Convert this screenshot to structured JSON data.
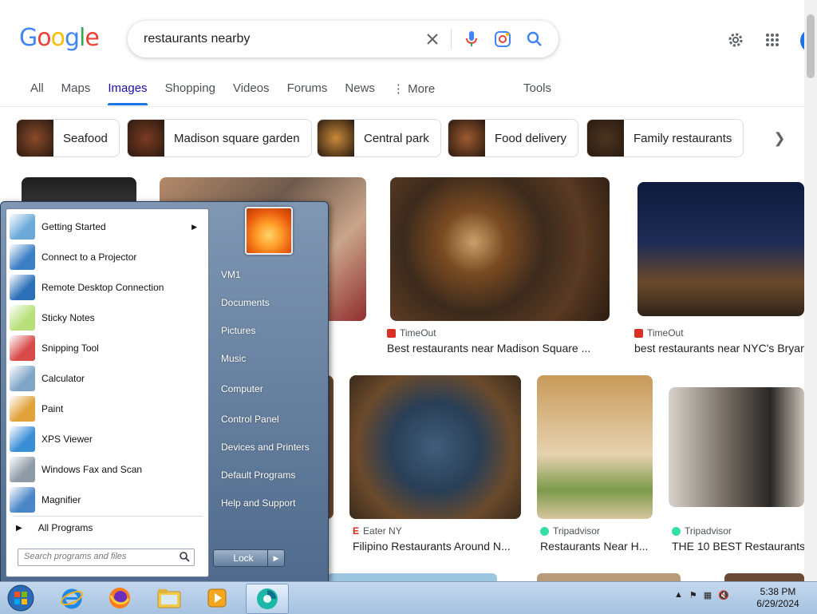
{
  "google": {
    "logo_letters": [
      "G",
      "o",
      "o",
      "g",
      "l",
      "e"
    ],
    "logo_colors": [
      "#4285F4",
      "#EA4335",
      "#FBBC05",
      "#4285F4",
      "#34A853",
      "#EA4335"
    ],
    "query": "restaurants nearby",
    "tabs": [
      {
        "label": "All",
        "active": false
      },
      {
        "label": "Maps",
        "active": false
      },
      {
        "label": "Images",
        "active": true
      },
      {
        "label": "Shopping",
        "active": false
      },
      {
        "label": "Videos",
        "active": false
      },
      {
        "label": "Forums",
        "active": false
      },
      {
        "label": "News",
        "active": false
      },
      {
        "label": "More",
        "active": false
      }
    ],
    "tools_label": "Tools",
    "chips": [
      {
        "label": "Seafood",
        "color": "#8a4b2a"
      },
      {
        "label": "Madison square garden",
        "color": "#7a3b22"
      },
      {
        "label": "Central park",
        "color": "#c98a3a"
      },
      {
        "label": "Food delivery",
        "color": "#9c5a2f"
      },
      {
        "label": "Family restaurants",
        "color": "#4a3520"
      }
    ],
    "results": [
      {
        "source": "TimeOut",
        "title": "Best restaurants near Madison Square ...",
        "fav_color": "#d93025"
      },
      {
        "source": "TimeOut",
        "title": "best restaurants near NYC's Bryant",
        "fav_color": "#d93025"
      },
      {
        "source": "Eater NY",
        "title": "Filipino Restaurants Around N...",
        "fav_color": "#e2231a"
      },
      {
        "source": "Tripadvisor",
        "title": "Restaurants Near H...",
        "fav_color": "#34e0a1"
      },
      {
        "source": "Tripadvisor",
        "title": "THE 10 BEST Restaurants",
        "fav_color": "#34e0a1"
      }
    ]
  },
  "startmenu": {
    "programs": [
      {
        "label": "Getting Started",
        "has_arrow": true,
        "icon": "getting-started-icon",
        "color": "#6aa9d8"
      },
      {
        "label": "Connect to a Projector",
        "has_arrow": false,
        "icon": "projector-icon",
        "color": "#3c7fc4"
      },
      {
        "label": "Remote Desktop Connection",
        "has_arrow": false,
        "icon": "remote-desktop-icon",
        "color": "#2a6fb8"
      },
      {
        "label": "Sticky Notes",
        "has_arrow": false,
        "icon": "sticky-notes-icon",
        "color": "#b7e07a"
      },
      {
        "label": "Snipping Tool",
        "has_arrow": false,
        "icon": "scissors-icon",
        "color": "#d94a4a"
      },
      {
        "label": "Calculator",
        "has_arrow": false,
        "icon": "calculator-icon",
        "color": "#7fa6c7"
      },
      {
        "label": "Paint",
        "has_arrow": false,
        "icon": "paint-icon",
        "color": "#e2a23a"
      },
      {
        "label": "XPS Viewer",
        "has_arrow": false,
        "icon": "xps-viewer-icon",
        "color": "#3a8ed6"
      },
      {
        "label": "Windows Fax and Scan",
        "has_arrow": false,
        "icon": "fax-scan-icon",
        "color": "#8e9aa6"
      },
      {
        "label": "Magnifier",
        "has_arrow": false,
        "icon": "magnifier-icon",
        "color": "#4a86c8"
      }
    ],
    "all_programs": "All Programs",
    "search_placeholder": "Search programs and files",
    "right_items": [
      "VM1",
      "Documents",
      "Pictures",
      "Music",
      "Computer",
      "Control Panel",
      "Devices and Printers",
      "Default Programs",
      "Help and Support"
    ],
    "lock_label": "Lock"
  },
  "taskbar": {
    "time": "5:38 PM",
    "date": "6/29/2024"
  }
}
